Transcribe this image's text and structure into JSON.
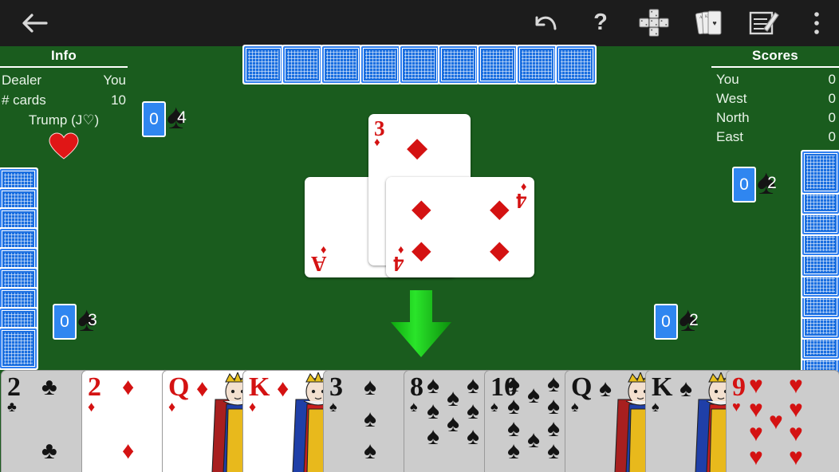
{
  "app": {
    "table_color": "#1a5c1e",
    "toolbar_color": "#1c1c1c",
    "red": "#d41212",
    "black": "#141414",
    "bid_card_color": "#2f86f0",
    "turn_arrow_color": "#21cc21"
  },
  "toolbar": {
    "back_label": "Back",
    "icons": [
      {
        "name": "undo-icon",
        "label": "Undo"
      },
      {
        "name": "help-icon",
        "label": "Help"
      },
      {
        "name": "card-layout-icon",
        "label": "Table layout"
      },
      {
        "name": "cards-fan-icon",
        "label": "Cards"
      },
      {
        "name": "scorepad-icon",
        "label": "Scorepad"
      },
      {
        "name": "overflow-menu-icon",
        "label": "More options"
      }
    ]
  },
  "info": {
    "title": "Info",
    "rows": [
      {
        "label": "Dealer",
        "value": "You"
      },
      {
        "label": "# cards",
        "value": "10"
      }
    ],
    "trump_label": "Trump (J♡)",
    "trump_suit": "♥",
    "trump_suit_name": "hearts"
  },
  "scores": {
    "title": "Scores",
    "rows": [
      {
        "label": "You",
        "value": "0"
      },
      {
        "label": "West",
        "value": "0"
      },
      {
        "label": "North",
        "value": "0"
      },
      {
        "label": "East",
        "value": "0"
      }
    ]
  },
  "counters": {
    "north": {
      "bid": "0",
      "tricks": "4"
    },
    "west": {
      "bid": "0",
      "tricks": "3"
    },
    "east": {
      "bid": "0",
      "tricks": "2"
    },
    "south": {
      "bid": "0",
      "tricks": "2"
    }
  },
  "trick": {
    "cards": [
      {
        "rank": "3",
        "suit": "♦",
        "suit_name": "diamonds",
        "color": "red",
        "position": "north"
      },
      {
        "rank": "A",
        "suit": "♦",
        "suit_name": "diamonds",
        "color": "red",
        "position": "west"
      },
      {
        "rank": "4",
        "suit": "♦",
        "suit_name": "diamonds",
        "color": "red",
        "position": "east"
      }
    ]
  },
  "opponent_cards": {
    "north_count": 9,
    "west_count": 9,
    "east_count": 10
  },
  "turn_indicator": {
    "direction": "down",
    "player": "You"
  },
  "hand": {
    "cards": [
      {
        "rank": "2",
        "suit": "♣",
        "suit_name": "clubs",
        "color": "black",
        "playable": false
      },
      {
        "rank": "2",
        "suit": "♦",
        "suit_name": "diamonds",
        "color": "red",
        "playable": true
      },
      {
        "rank": "Q",
        "suit": "♦",
        "suit_name": "diamonds",
        "color": "red",
        "playable": true
      },
      {
        "rank": "K",
        "suit": "♦",
        "suit_name": "diamonds",
        "color": "red",
        "playable": true
      },
      {
        "rank": "3",
        "suit": "♠",
        "suit_name": "spades",
        "color": "black",
        "playable": false
      },
      {
        "rank": "8",
        "suit": "♠",
        "suit_name": "spades",
        "color": "black",
        "playable": false
      },
      {
        "rank": "10",
        "suit": "♠",
        "suit_name": "spades",
        "color": "black",
        "playable": false
      },
      {
        "rank": "Q",
        "suit": "♠",
        "suit_name": "spades",
        "color": "black",
        "playable": false
      },
      {
        "rank": "K",
        "suit": "♠",
        "suit_name": "spades",
        "color": "black",
        "playable": false
      },
      {
        "rank": "9",
        "suit": "♥",
        "suit_name": "hearts",
        "color": "red",
        "playable": false
      }
    ]
  }
}
